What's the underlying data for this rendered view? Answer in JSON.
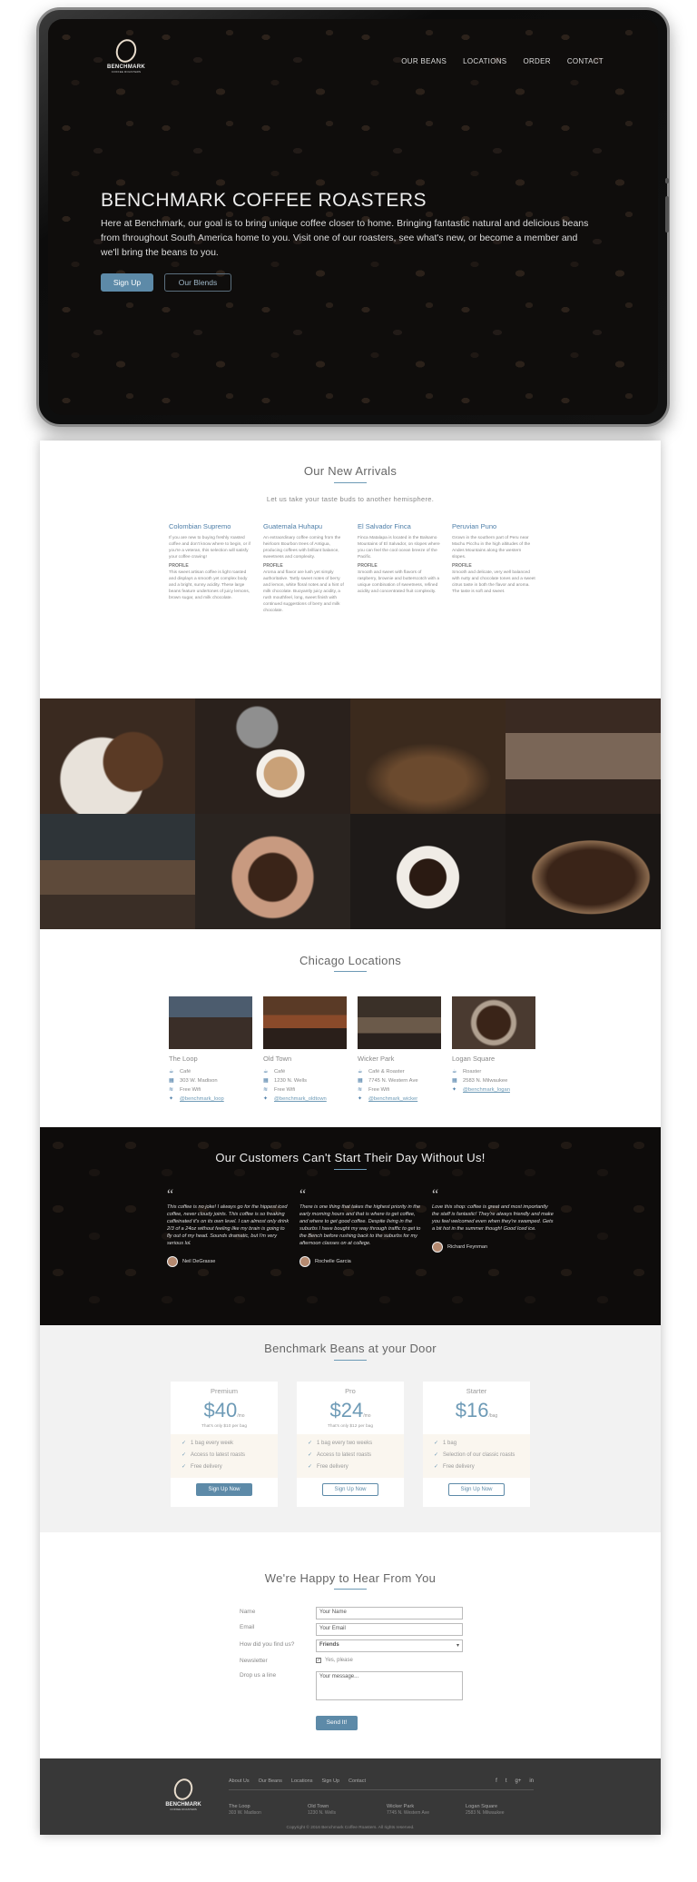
{
  "brand": {
    "name": "BENCHMARK",
    "tagline": "COFFEE ROASTERS"
  },
  "nav": [
    "OUR BEANS",
    "LOCATIONS",
    "ORDER",
    "CONTACT"
  ],
  "hero": {
    "title": "BENCHMARK COFFEE ROASTERS",
    "text": "Here at Benchmark, our goal is to bring unique coffee closer to home. Bringing fantastic natural and delicious beans from throughout South America home to you. Visit one of our roasters, see what's new, or become a member and we'll bring the beans to you.",
    "signup": "Sign Up",
    "blends": "Our Blends"
  },
  "arrivals": {
    "title": "Our New Arrivals",
    "subtitle": "Let us take your taste buds to another hemisphere.",
    "items": [
      {
        "name": "Colombian Supremo",
        "desc": "If you are new to buying freshly roasted coffee and don't know where to begin, or if you're a veteran, this selection will satisfy your coffee craving!",
        "profile_label": "PROFILE",
        "profile": "This sweet artisan coffee is light roasted and displays a smooth yet complex body and a bright, sunny acidity. These large beans feature undertones of juicy lemons, brown sugar, and milk chocolate."
      },
      {
        "name": "Guatemala Huhapu",
        "desc": "An extraordinary coffee coming from the heirloom Bourbon trees of Antigua, producing coffees with brilliant balance, sweetness and complexity.",
        "profile_label": "PROFILE",
        "profile": "Aroma and flavor are lush yet simply authoritative. Tartly sweet notes of berry and lemon, white floral notes and a hint of milk chocolate. Buoyantly juicy acidity, a rush mouthfeel, long, sweet finish with continued suggestions of berry and milk chocolate."
      },
      {
        "name": "El Salvador Finca",
        "desc": "Finca Matalapa is located in the Balsamo Mountains of El Salvador, on slopes where you can feel the cool ocean breeze of the Pacific.",
        "profile_label": "PROFILE",
        "profile": "Smooth and sweet with flavors of raspberry, brownie and butterscotch with a unique combination of sweetness, refined acidity and concentrated fruit complexity."
      },
      {
        "name": "Peruvian Puno",
        "desc": "Grown in the southern part of Peru near Machu Picchu in the high altitudes of the Andes Mountains along the western slopes.",
        "profile_label": "PROFILE",
        "profile": "Smooth and delicate, very well balanced with nutty and chocolate tones and a sweet citrus taste in both the flavor and aroma. The taste is soft and sweet."
      }
    ]
  },
  "locations": {
    "title": "Chicago Locations",
    "items": [
      {
        "name": "The Loop",
        "type": "Café",
        "address": "303 W. Madison",
        "wifi": "Free Wifi",
        "twitter": "@benchmark_loop"
      },
      {
        "name": "Old Town",
        "type": "Café",
        "address": "1230 N. Wells",
        "wifi": "Free Wifi",
        "twitter": "@benchmark_oldtown"
      },
      {
        "name": "Wicker Park",
        "type": "Café & Roaster",
        "address": "7745 N. Western Ave",
        "wifi": "Free Wifi",
        "twitter": "@benchmark_wicker"
      },
      {
        "name": "Logan Square",
        "type": "Roaster",
        "address": "2583 N. Milwaukee",
        "twitter": "@benchmark_logan"
      }
    ]
  },
  "testimonials": {
    "title": "Our Customers Can't Start Their Day Without Us!",
    "items": [
      {
        "text": "This coffee is no joke! I always go for the hippest iced coffee, never cloudy joints. This coffee is so freaking caffeinated it's on its own level. I can almost only drink 2/3 of a 24oz without feeling like my brain is going to fly out of my head. Sounds dramatic, but I'm very serious lol.",
        "author": "Neil DeGrasse"
      },
      {
        "text": "There is one thing that takes the highest priority in the early morning hours and that is where to get coffee, and where to get good coffee. Despite living in the suburbs I have bought my way through traffic to get to the Bench before rushing back to the suburbs for my afternoon classes on at college.",
        "author": "Rochelle Garcia"
      },
      {
        "text": "Love this shop: coffee is great and most importantly the staff is fantastic! They're always friendly and make you feel welcomed even when they're swamped. Gets a bit hot in the summer though! Good Iced ice.",
        "author": "Richard Feynman"
      }
    ]
  },
  "pricing": {
    "title": "Benchmark Beans at your Door",
    "plans": [
      {
        "name": "Premium",
        "price": "$40",
        "unit": "/mo",
        "per": "That's only $10 per bag",
        "features": [
          "1 bag every week",
          "Access to latest roasts",
          "Free delivery"
        ],
        "button": "Sign Up Now"
      },
      {
        "name": "Pro",
        "price": "$24",
        "unit": "/mo",
        "per": "That's only $12 per bag",
        "features": [
          "1 bag every two weeks",
          "Access to latest roasts",
          "Free delivery"
        ],
        "button": "Sign Up Now"
      },
      {
        "name": "Starter",
        "price": "$16",
        "unit": "/bag",
        "per": "",
        "features": [
          "1 bag",
          "Selection of our classic roasts",
          "Free delivery"
        ],
        "button": "Sign Up Now"
      }
    ]
  },
  "contact": {
    "title": "We're Happy to Hear From You",
    "labels": {
      "name": "Name",
      "email": "Email",
      "found": "How did you find us?",
      "newsletter": "Newsletter",
      "message": "Drop us a line"
    },
    "name_placeholder": "Your Name",
    "email_placeholder": "Your Email",
    "found_value": "Friends",
    "newsletter_value": "Yes, please",
    "message_placeholder": "Your message...",
    "send": "Send It!"
  },
  "footer": {
    "links": [
      "About Us",
      "Our Beans",
      "Locations",
      "Sign Up",
      "Contact"
    ],
    "social": [
      "f",
      "t",
      "g+",
      "in"
    ],
    "locations": [
      {
        "name": "The Loop",
        "addr": "303 W. Madison"
      },
      {
        "name": "Old Town",
        "addr": "1230 N. Wells"
      },
      {
        "name": "Wicker Park",
        "addr": "7745 N. Western Ave"
      },
      {
        "name": "Logan Square",
        "addr": "2583 N. Milwaukee"
      }
    ],
    "copyright": "Copyright © 2016 Benchmark Coffee Roasters. All rights reserved."
  },
  "colors": {
    "accent": "#5d8aa8",
    "link": "#4d7ea8",
    "footer": "#383838"
  }
}
